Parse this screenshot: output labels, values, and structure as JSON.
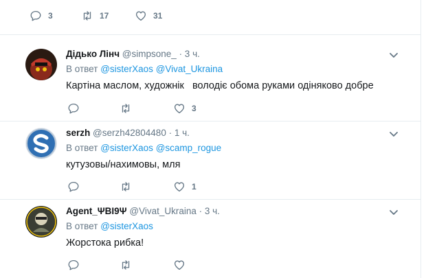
{
  "top_actions": {
    "reply_count": "3",
    "retweet_count": "17",
    "like_count": "31"
  },
  "tweets": [
    {
      "name": "Дідько Лінч",
      "handle": "@simpsone_",
      "time": "· 3 ч.",
      "reply_prefix": "В ответ",
      "mentions": [
        "@sisterXaos",
        "@Vivat_Ukraina"
      ],
      "text": "Картіна маслом, художнік   володіє обома руками одіняково добре",
      "reply_count": "",
      "retweet_count": "",
      "like_count": "3"
    },
    {
      "name": "serzh",
      "handle": "@serzh42804480",
      "time": "· 1 ч.",
      "reply_prefix": "В ответ",
      "mentions": [
        "@sisterXaos",
        "@scamp_rogue"
      ],
      "text": "кутузовы/нахимовы, мля",
      "reply_count": "",
      "retweet_count": "",
      "like_count": "1"
    },
    {
      "name": "Agent_ΨBI9Ψ",
      "handle": "@Vivat_Ukraina",
      "time": "· 3 ч.",
      "reply_prefix": "В ответ",
      "mentions": [
        "@sisterXaos"
      ],
      "text": "Жорстока рибка!",
      "reply_count": "",
      "retweet_count": "",
      "like_count": ""
    }
  ],
  "colors": {
    "muted": "#657786",
    "link": "#1b95e0",
    "text": "#14171a",
    "divider": "#e6ecf0"
  }
}
